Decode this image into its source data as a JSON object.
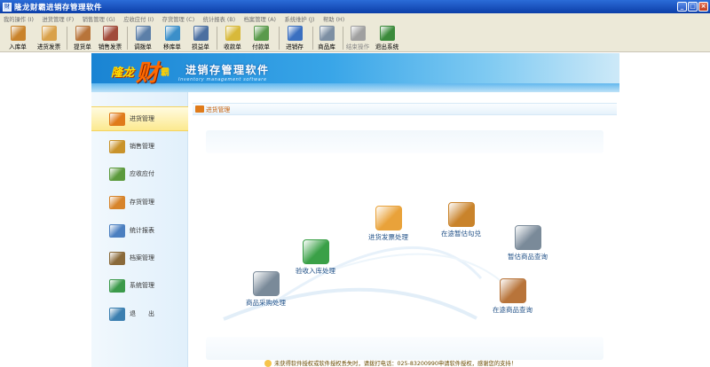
{
  "window": {
    "title": "隆龙财霸进销存管理软件",
    "controls": [
      "_",
      "□",
      "×"
    ]
  },
  "menu": {
    "items": [
      "我的操作 (I)",
      "进货管理 (F)",
      "销售管理 (G)",
      "应收应付 (I)",
      "存货管理 (C)",
      "统计报表 (B)",
      "档案管理 (A)",
      "系统维护 (J)",
      "帮助 (H)"
    ]
  },
  "toolbar": {
    "buttons": [
      {
        "label": "入库单",
        "icon": "stock-in-icon",
        "color": "#c9832b"
      },
      {
        "label": "进货发票",
        "icon": "purchase-invoice-icon",
        "color": "#d9a14a"
      },
      {
        "label": "提货单",
        "icon": "pickup-order-icon",
        "color": "#b8743a"
      },
      {
        "label": "销售发票",
        "icon": "sales-invoice-icon",
        "color": "#a14a3a"
      },
      {
        "label": "调拨单",
        "icon": "transfer-order-icon",
        "color": "#5c7fa8"
      },
      {
        "label": "移库单",
        "icon": "move-order-icon",
        "color": "#3b8fc9"
      },
      {
        "label": "损益单",
        "icon": "profit-loss-icon",
        "color": "#4b6fa0"
      },
      {
        "label": "收款单",
        "icon": "receipt-icon",
        "color": "#d8b93a"
      },
      {
        "label": "付款单",
        "icon": "payment-icon",
        "color": "#5a9a4c"
      },
      {
        "label": "进销存",
        "icon": "inventory-icon",
        "color": "#3a6fc0"
      },
      {
        "label": "商品库",
        "icon": "product-library-icon",
        "color": "#7d8fa3"
      },
      {
        "label": "结束操作",
        "icon": "end-operation-icon",
        "color": "#a0a0a0",
        "disabled": true
      },
      {
        "label": "退出系统",
        "icon": "exit-system-icon",
        "color": "#3b8a3b"
      }
    ]
  },
  "banner": {
    "logo_long": "隆龙",
    "logo_cai": "财",
    "logo_ba": "霸",
    "product_title": "进销存管理软件",
    "product_subtitle": "Inventory management software"
  },
  "sidebar": {
    "items": [
      {
        "label": "进货管理",
        "icon": "truck-icon",
        "color": "#e07b1a",
        "active": true
      },
      {
        "label": "销售管理",
        "icon": "sales-icon",
        "color": "#c9932b"
      },
      {
        "label": "应收应付",
        "icon": "money-icon",
        "color": "#5c9a3c"
      },
      {
        "label": "存货管理",
        "icon": "warehouse-box-icon",
        "color": "#d7842b"
      },
      {
        "label": "统计报表",
        "icon": "report-chart-icon",
        "color": "#4b7fc0"
      },
      {
        "label": "档案管理",
        "icon": "archive-icon",
        "color": "#8a6a3a"
      },
      {
        "label": "系统管理",
        "icon": "system-settings-icon",
        "color": "#3b9a4a"
      },
      {
        "label": "退　　出",
        "icon": "exit-door-icon",
        "color": "#3b7fb0"
      }
    ]
  },
  "breadcrumb": {
    "label": "进货管理"
  },
  "flow": {
    "nodes": [
      {
        "label": "商品采购处理",
        "icon": "purchase-process-icon",
        "color": "#7a8a99"
      },
      {
        "label": "验收入库处理",
        "icon": "check-in-icon",
        "color": "#3aa047"
      },
      {
        "label": "进货发票处理",
        "icon": "invoice-process-icon",
        "color": "#e9a23a"
      },
      {
        "label": "在途暂估勾兑",
        "icon": "clipboard-icon",
        "color": "#c9832b"
      },
      {
        "label": "暂估商品查询",
        "icon": "estimate-query-icon",
        "color": "#7a8a99"
      },
      {
        "label": "在途商品查询",
        "icon": "transit-query-icon",
        "color": "#b8743a"
      }
    ]
  },
  "footer": {
    "notice": "未获得软件授权或软件授权丢失时，请拨打电话：025-83200990申请软件授权，感谢您的支持！"
  }
}
